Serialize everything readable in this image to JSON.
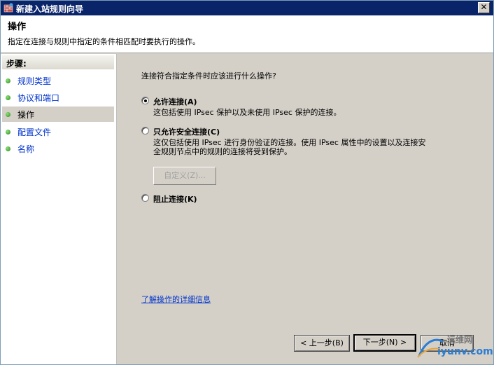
{
  "window": {
    "title": "新建入站规则向导",
    "close_glyph": "✕"
  },
  "header": {
    "title": "操作",
    "subtitle": "指定在连接与规则中指定的条件相匹配时要执行的操作。"
  },
  "sidebar": {
    "heading": "步骤:",
    "items": [
      {
        "label": "规则类型",
        "active": false
      },
      {
        "label": "协议和端口",
        "active": false
      },
      {
        "label": "操作",
        "active": true
      },
      {
        "label": "配置文件",
        "active": false
      },
      {
        "label": "名称",
        "active": false
      }
    ]
  },
  "main": {
    "question": "连接符合指定条件时应该进行什么操作?",
    "options": [
      {
        "label": "允许连接(A)",
        "description": "这包括使用 IPsec 保护以及未使用 IPsec 保护的连接。",
        "selected": true
      },
      {
        "label": "只允许安全连接(C)",
        "description_line1": "这仅包括使用 IPsec 进行身份验证的连接。使用 IPsec 属性中的设置以及连接安",
        "description_line2": "全规则节点中的规则的连接将受到保护。",
        "selected": false
      },
      {
        "label": "阻止连接(K)",
        "selected": false
      }
    ],
    "custom_button": "自定义(Z)...",
    "help_link": "了解操作的详细信息"
  },
  "footer": {
    "back": "< 上一步(B)",
    "next": "下一步(N) >",
    "cancel": "取消"
  },
  "watermark": {
    "top": "运维网",
    "bottom": "iyunv.com"
  },
  "colors": {
    "titlebar": "#0a246a",
    "link": "#0033cc",
    "step_dot": "#2a8a1a"
  }
}
